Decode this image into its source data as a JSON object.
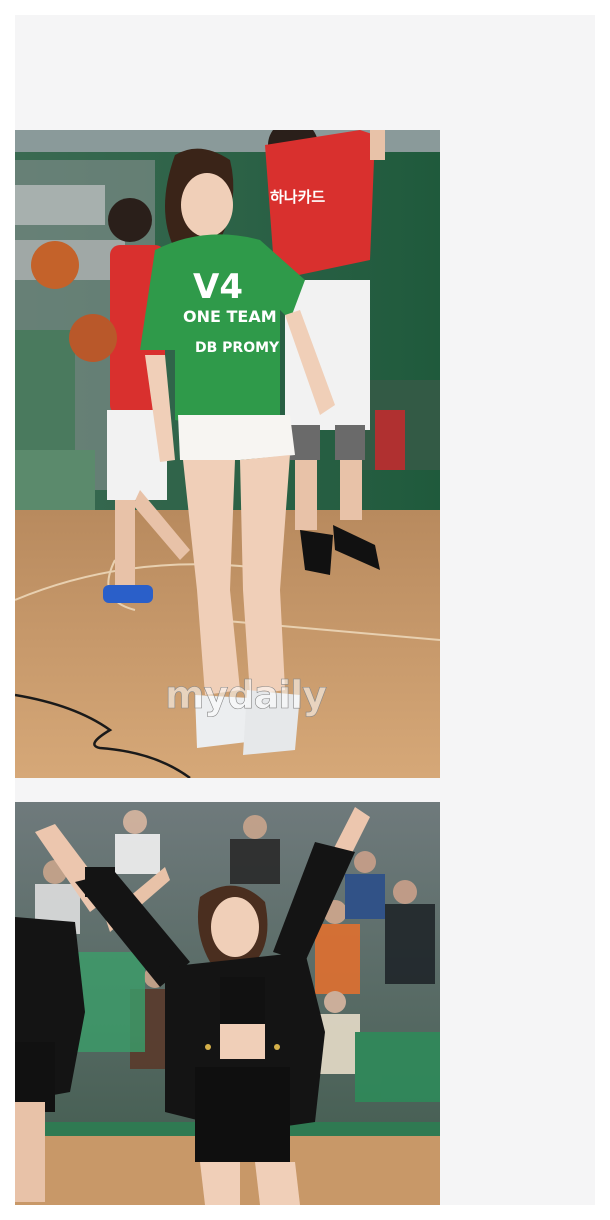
{
  "photos": [
    {
      "id": "cheerleader-court",
      "watermark": "mydaily",
      "shirt_lines": [
        "V4",
        "ONE TEAM",
        "DB PROMY"
      ],
      "jersey_text": "하나카드"
    },
    {
      "id": "cheerleader-performance"
    }
  ],
  "colors": {
    "shirt_green": "#2f9a4a",
    "jersey_red": "#d9302e",
    "court_wood": "#c89868",
    "jacket_black": "#141414",
    "panel_bg": "#f5f5f6"
  }
}
